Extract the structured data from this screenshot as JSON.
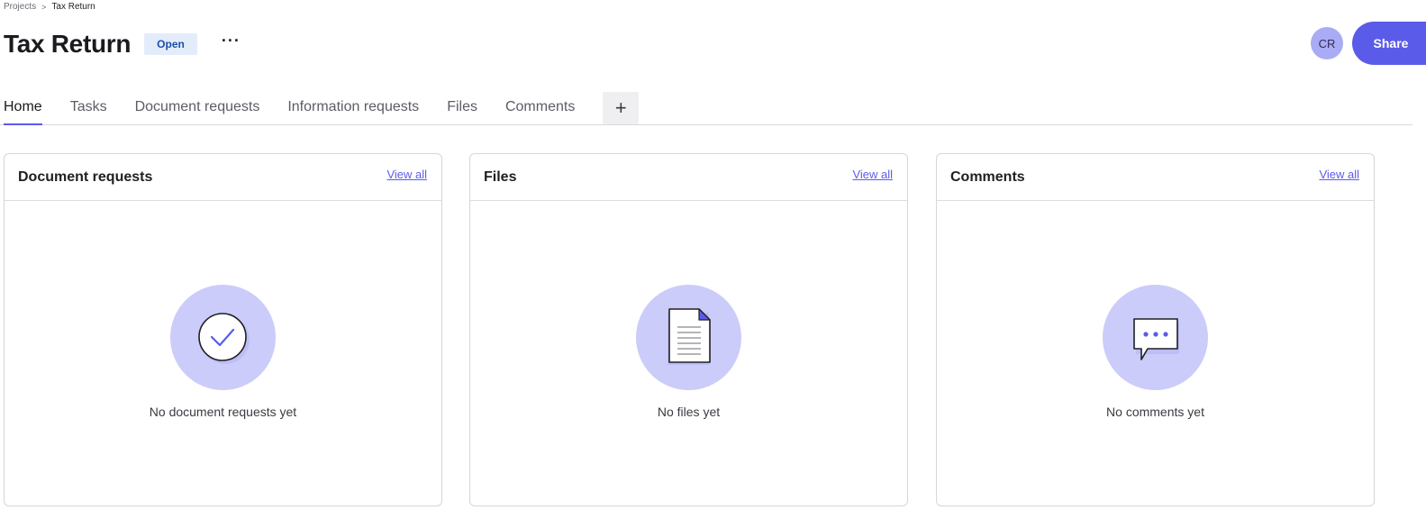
{
  "breadcrumb": {
    "parent": "Projects",
    "separator": ">",
    "current": "Tax Return"
  },
  "header": {
    "title": "Tax Return",
    "status": "Open",
    "more_label": "···",
    "avatar_initials": "CR",
    "share_label": "Share"
  },
  "tabs": [
    {
      "label": "Home",
      "active": true
    },
    {
      "label": "Tasks"
    },
    {
      "label": "Document requests"
    },
    {
      "label": "Information requests"
    },
    {
      "label": "Files"
    },
    {
      "label": "Comments"
    }
  ],
  "add_tab_label": "+",
  "cards": [
    {
      "title": "Document requests",
      "view_all": "View all",
      "empty_text": "No document requests yet",
      "icon": "check-circle-icon"
    },
    {
      "title": "Files",
      "view_all": "View all",
      "empty_text": "No files yet",
      "icon": "document-icon"
    },
    {
      "title": "Comments",
      "view_all": "View all",
      "empty_text": "No comments yet",
      "icon": "chat-bubble-icon"
    }
  ],
  "colors": {
    "accent": "#5b5bea",
    "illustration_bg": "#cbccfa",
    "badge_bg": "#e3ecfb",
    "badge_text": "#1d4fa8"
  }
}
